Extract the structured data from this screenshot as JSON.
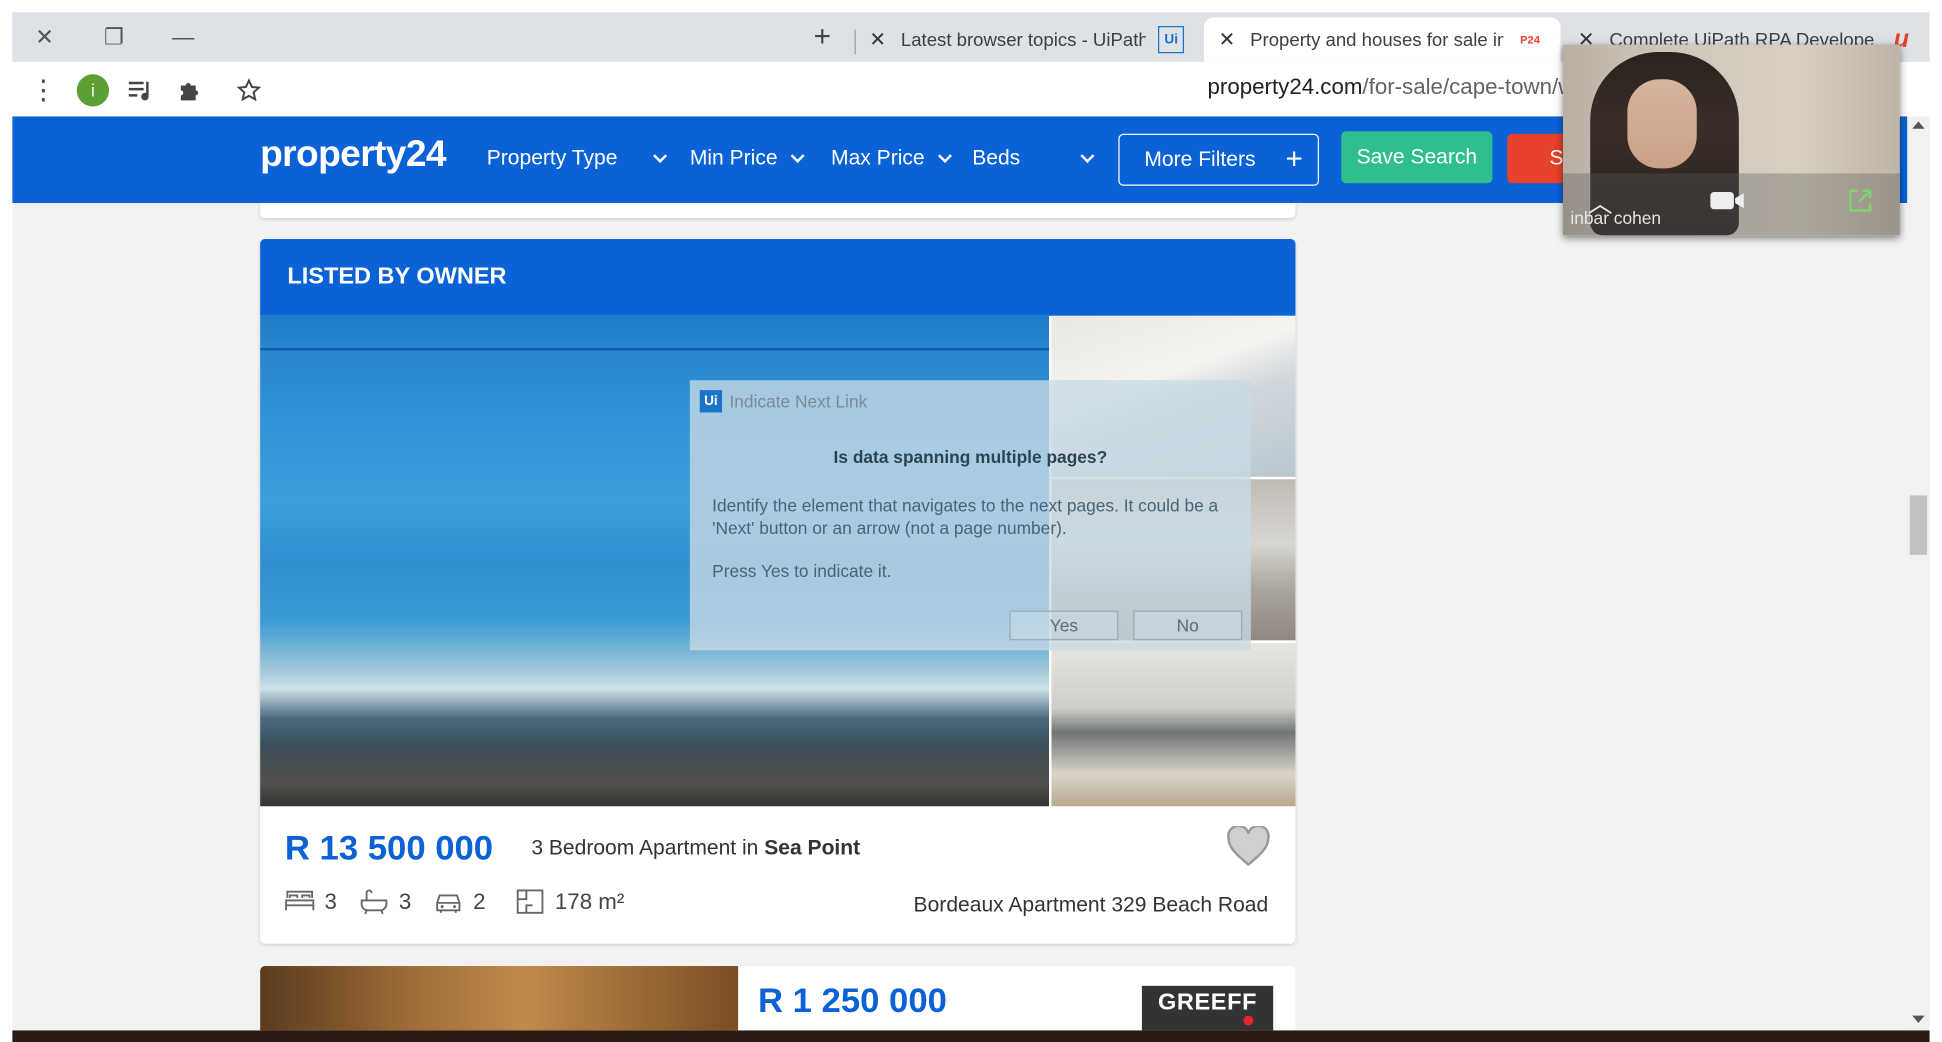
{
  "browser": {
    "tabs": [
      {
        "title": "Latest browser topics - UiPath Co",
        "favicon": "Ui",
        "active": false
      },
      {
        "title": "Property and houses for sale in C",
        "favicon": "P24",
        "active": true
      },
      {
        "title": "Complete UiPath RPA Developer",
        "favicon": "u",
        "active": false
      }
    ],
    "new_tab": "+",
    "avatar_letter": "i",
    "url_host": "property24.com",
    "url_path": "/for-sale/cape-town/w"
  },
  "site": {
    "logo": "property24",
    "nav": {
      "property_type": "Property Type",
      "min_price": "Min Price",
      "max_price": "Max Price",
      "beds": "Beds"
    },
    "more_filters": "More Filters",
    "save_search": "Save Search",
    "search_partial": "S"
  },
  "listing": {
    "header": "LISTED BY OWNER",
    "price": "R 13 500 000",
    "title_prefix": "3 Bedroom Apartment in ",
    "title_suburb": "Sea Point",
    "bedrooms": "3",
    "bathrooms": "3",
    "parking": "2",
    "floor_size": "178 m²",
    "address": "Bordeaux Apartment 329 Beach Road"
  },
  "next_listing": {
    "price": "R 1 250 000",
    "agency": "GREEFF"
  },
  "uipath_dialog": {
    "title": "Indicate Next Link",
    "question": "Is data spanning multiple pages?",
    "description": "Identify the element that navigates to the next pages. It could be a 'Next' button or an arrow (not a page number).",
    "instruction": "Press Yes to indicate it.",
    "yes": "Yes",
    "no": "No"
  },
  "video_call": {
    "participant": "inbar cohen"
  },
  "colors": {
    "brand_blue": "#0b61d6",
    "save_green": "#2fbf8f",
    "search_red": "#e8412c"
  }
}
